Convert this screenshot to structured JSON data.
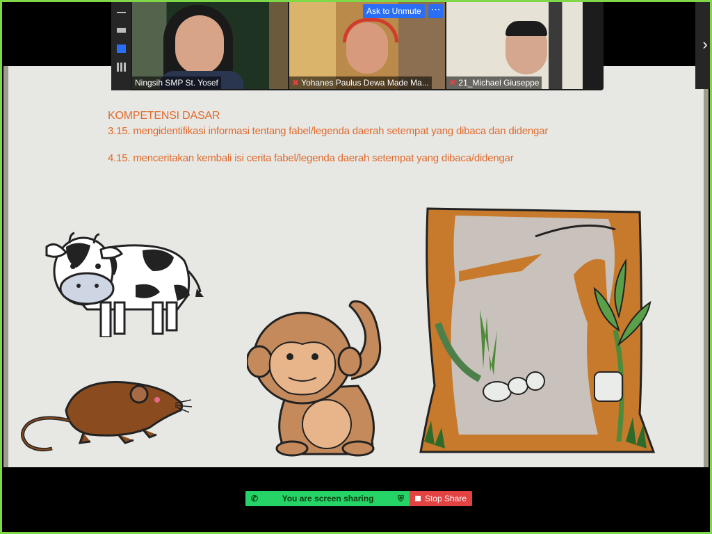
{
  "meeting": {
    "ask_to_unmute": "Ask to Unmute",
    "more_label": "⋯",
    "participants": [
      {
        "name": "Ningsih SMP St. Yosef",
        "muted": false
      },
      {
        "name": "Yohanes Paulus Dewa Made Ma...",
        "muted": true
      },
      {
        "name": "21_Michael Giuseppe",
        "muted": true
      }
    ],
    "next_label": "›"
  },
  "slide": {
    "title": "KOMPETENSI DASAR",
    "line1": "3.15. mengidentifikasi informasi tentang fabel/legenda daerah setempat yang dibaca dan didengar",
    "line2": "4.15. menceritakan kembali isi cerita fabel/legenda daerah setempat yang dibaca/didengar"
  },
  "sharing": {
    "status": "You are screen sharing",
    "stop_label": "Stop Share"
  },
  "colors": {
    "accent_green": "#25d366",
    "stop_red": "#e34242",
    "slide_text": "#e06a2c",
    "zoom_blue": "#2b6ef6"
  }
}
